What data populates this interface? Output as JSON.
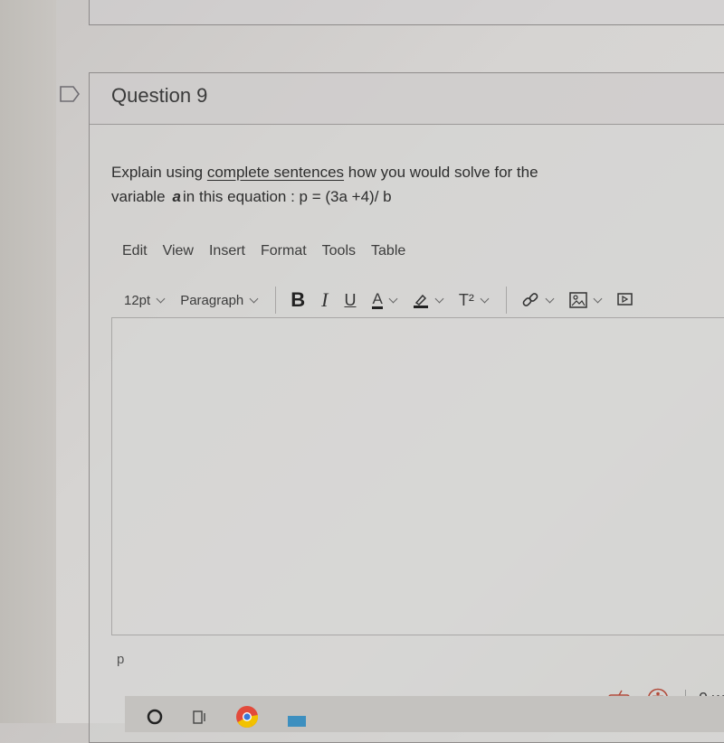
{
  "question": {
    "title": "Question 9",
    "text_before_link": "Explain using ",
    "underlined_phrase": "complete sentences",
    "text_after_link": " how you would solve for the",
    "line2_before_var": "variable",
    "variable": "a",
    "line2_after_var": "in this equation : p = (3a +4)/ b"
  },
  "editor": {
    "menu": [
      "Edit",
      "View",
      "Insert",
      "Format",
      "Tools",
      "Table"
    ],
    "font_size": "12pt",
    "block_format": "Paragraph",
    "bold_label": "B",
    "italic_label": "I",
    "underline_label": "U",
    "text_color_label": "A",
    "superscript_label": "T²",
    "content": "",
    "status_path": "p",
    "word_count": "0 w"
  },
  "colors": {
    "accent_icon": "#b24a3a"
  }
}
